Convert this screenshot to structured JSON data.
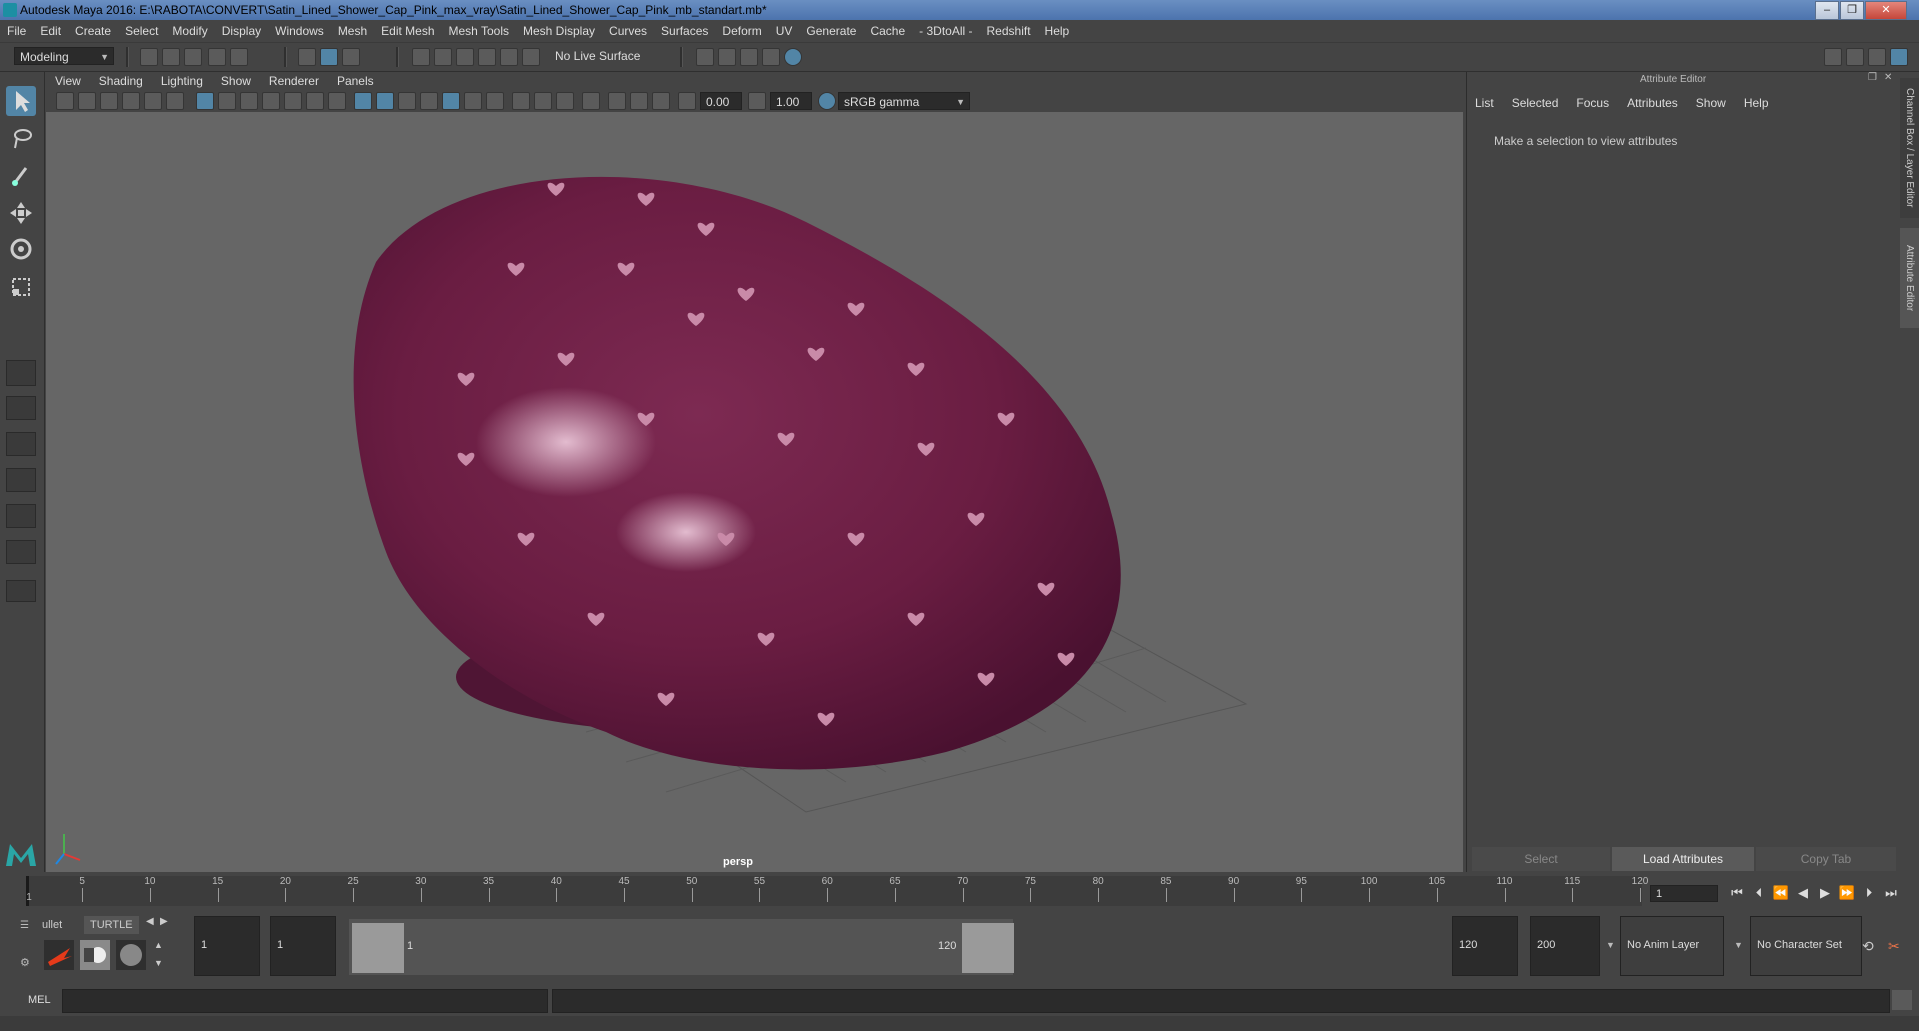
{
  "window": {
    "title": "Autodesk Maya 2016: E:\\RABOTA\\CONVERT\\Satin_Lined_Shower_Cap_Pink_max_vray\\Satin_Lined_Shower_Cap_Pink_mb_standart.mb*"
  },
  "menubar": [
    "File",
    "Edit",
    "Create",
    "Select",
    "Modify",
    "Display",
    "Windows",
    "Mesh",
    "Edit Mesh",
    "Mesh Tools",
    "Mesh Display",
    "Curves",
    "Surfaces",
    "Deform",
    "UV",
    "Generate",
    "Cache",
    "- 3DtoAll -",
    "Redshift",
    "Help"
  ],
  "statusline": {
    "mode": "Modeling",
    "live_surface": "No Live Surface"
  },
  "panel": {
    "menu": [
      "View",
      "Shading",
      "Lighting",
      "Show",
      "Renderer",
      "Panels"
    ],
    "exposure": "0.00",
    "gamma": "1.00",
    "color_space": "sRGB gamma",
    "camera_label": "persp"
  },
  "attribute_editor": {
    "title": "Attribute Editor",
    "menu": [
      "List",
      "Selected",
      "Focus",
      "Attributes",
      "Show",
      "Help"
    ],
    "message": "Make a selection to view attributes",
    "buttons": {
      "select": "Select",
      "load": "Load Attributes",
      "copy": "Copy Tab"
    }
  },
  "side_tabs": {
    "channel_box": "Channel Box / Layer Editor",
    "attribute_editor": "Attribute Editor"
  },
  "timeline": {
    "ticks": [
      "5",
      "10",
      "15",
      "20",
      "25",
      "30",
      "35",
      "40",
      "45",
      "50",
      "55",
      "60",
      "65",
      "70",
      "75",
      "80",
      "85",
      "90",
      "95",
      "100",
      "105",
      "110",
      "115",
      "120"
    ],
    "start_marker": "1",
    "current_frame": "1"
  },
  "shelf": {
    "tab1": "ullet",
    "tab2": "TURTLE"
  },
  "range": {
    "start": "1",
    "playback_start": "1",
    "range_min_label": "1",
    "range_max_label": "120",
    "playback_end": "120",
    "end": "200",
    "anim_layer": "No Anim Layer",
    "character_set": "No Character Set"
  },
  "command_line": {
    "label": "MEL"
  },
  "colors": {
    "cap": "#6e1f45",
    "heart": "#c98aa8",
    "viewport": "#666666",
    "highlight": "#5285a6"
  }
}
